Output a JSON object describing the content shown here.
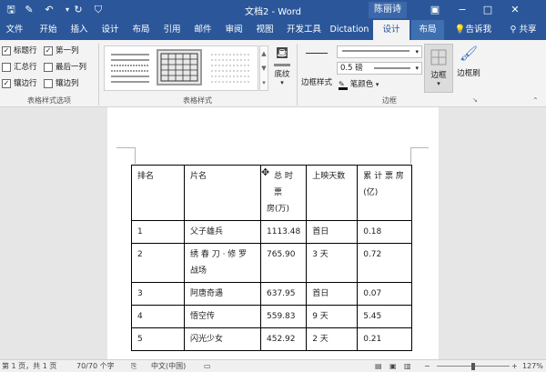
{
  "title_bar": {
    "doc_title": "文档2 - Word",
    "user_name": "陈丽诗",
    "quick_access": [
      "save-icon",
      "touch-mode-icon",
      "undo-icon",
      "redo-icon",
      "customize-icon"
    ]
  },
  "tabs": [
    "文件",
    "开始",
    "插入",
    "设计",
    "布局",
    "引用",
    "邮件",
    "审阅",
    "视图",
    "开发工具",
    "Dictation",
    "设计",
    "布局"
  ],
  "tell_me": "告诉我",
  "share": "共享",
  "table_style_options": {
    "group_label": "表格样式选项",
    "items": [
      {
        "label": "标题行",
        "checked": true
      },
      {
        "label": "汇总行",
        "checked": false
      },
      {
        "label": "镶边行",
        "checked": true
      },
      {
        "label": "第一列",
        "checked": true
      },
      {
        "label": "最后一列",
        "checked": false
      },
      {
        "label": "镶边列",
        "checked": false
      }
    ]
  },
  "table_styles": {
    "group_label": "表格样式",
    "shading_label": "底纹"
  },
  "borders": {
    "group_label": "边框",
    "border_styles_label": "边框样式",
    "weight_value": "0.5 磅",
    "pen_color_label": "笔颜色",
    "borders_label": "边框",
    "border_painter_label": "边框刷"
  },
  "table": {
    "headers": [
      "排名",
      "片名",
      "总票房(万)",
      "上映天数",
      "累计票房(亿)"
    ],
    "header_lines": [
      [
        "排名"
      ],
      [
        "片名"
      ],
      [
        "总 时 票",
        "房(万)"
      ],
      [
        "上映天数"
      ],
      [
        "累 计 票 房",
        "(亿)"
      ]
    ],
    "rows": [
      [
        "1",
        "父子雄兵",
        "1113.48",
        "首日",
        "0.18"
      ],
      [
        "2",
        "绣春刀 · 修罗战场",
        "765.90",
        "3 天",
        "0.72"
      ],
      [
        "3",
        "阿唐奇遇",
        "637.95",
        "首日",
        "0.07"
      ],
      [
        "4",
        "悟空传",
        "559.83",
        "9 天",
        "5.45"
      ],
      [
        "5",
        "闪光少女",
        "452.92",
        "2 天",
        "0.21"
      ]
    ],
    "row2_title_lines": [
      "绣 春 刀 · 修 罗",
      "战场"
    ]
  },
  "status_bar": {
    "page": "第 1 页，共 1 页",
    "words": "70/70 个字",
    "language": "中文(中国)",
    "zoom": "127%"
  },
  "colors": {
    "accent": "#2b579a",
    "ribbon_bg": "#f3f3f3"
  }
}
